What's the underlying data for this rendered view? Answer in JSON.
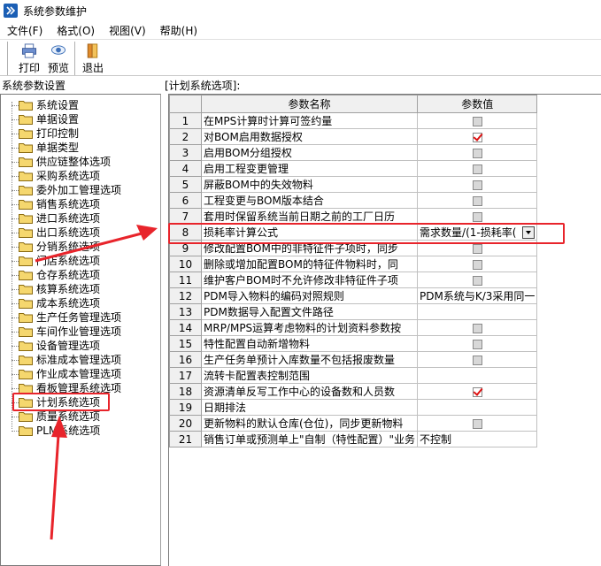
{
  "window": {
    "title": "系统参数维护"
  },
  "menu": [
    {
      "label": "文件(F)"
    },
    {
      "label": "格式(O)"
    },
    {
      "label": "视图(V)"
    },
    {
      "label": "帮助(H)"
    }
  ],
  "toolbar": {
    "print_label": "打印",
    "preview_label": "预览",
    "exit_label": "退出"
  },
  "left_panel": {
    "header": "系统参数设置"
  },
  "tree_items": [
    {
      "label": "系统设置"
    },
    {
      "label": "单据设置"
    },
    {
      "label": "打印控制"
    },
    {
      "label": "单据类型"
    },
    {
      "label": "供应链整体选项"
    },
    {
      "label": "采购系统选项"
    },
    {
      "label": "委外加工管理选项"
    },
    {
      "label": "销售系统选项"
    },
    {
      "label": "进口系统选项"
    },
    {
      "label": "出口系统选项"
    },
    {
      "label": "分销系统选项"
    },
    {
      "label": "门店系统选项"
    },
    {
      "label": "仓存系统选项"
    },
    {
      "label": "核算系统选项"
    },
    {
      "label": "成本系统选项"
    },
    {
      "label": "生产任务管理选项"
    },
    {
      "label": "车间作业管理选项"
    },
    {
      "label": "设备管理选项"
    },
    {
      "label": "标准成本管理选项"
    },
    {
      "label": "作业成本管理选项"
    },
    {
      "label": "看板管理系统选项"
    },
    {
      "label": "计划系统选项"
    },
    {
      "label": "质量系统选项"
    },
    {
      "label": "PLM系统选项"
    }
  ],
  "right_panel": {
    "header": "[计划系统选项]:"
  },
  "grid": {
    "col_name": "参数名称",
    "col_value": "参数值",
    "rows": [
      {
        "n": "1",
        "name": "在MPS计算时计算可签约量",
        "type": "cb",
        "checked": false
      },
      {
        "n": "2",
        "name": "对BOM启用数据授权",
        "type": "cb",
        "checked": true
      },
      {
        "n": "3",
        "name": "启用BOM分组授权",
        "type": "cb",
        "checked": false
      },
      {
        "n": "4",
        "name": "启用工程变更管理",
        "type": "cb",
        "checked": false
      },
      {
        "n": "5",
        "name": "屏蔽BOM中的失效物料",
        "type": "cb",
        "checked": false
      },
      {
        "n": "6",
        "name": "工程变更与BOM版本结合",
        "type": "cb",
        "checked": false
      },
      {
        "n": "7",
        "name": "套用时保留系统当前日期之前的工厂日历",
        "type": "cb",
        "checked": false
      },
      {
        "n": "8",
        "name": "损耗率计算公式",
        "type": "dd",
        "value": "需求数量/(1-损耗率("
      },
      {
        "n": "9",
        "name": "修改配置BOM中的非特征件子项时，同步",
        "type": "cb",
        "checked": false
      },
      {
        "n": "10",
        "name": "删除或增加配置BOM的特征件物料时，同",
        "type": "cb",
        "checked": false
      },
      {
        "n": "11",
        "name": "维护客户BOM时不允许修改非特征件子项",
        "type": "cb",
        "checked": false
      },
      {
        "n": "12",
        "name": "PDM导入物料的编码对照规则",
        "type": "text",
        "value": "PDM系统与K/3采用同一"
      },
      {
        "n": "13",
        "name": "PDM数据导入配置文件路径",
        "type": "text",
        "value": ""
      },
      {
        "n": "14",
        "name": "MRP/MPS运算考虑物料的计划资料参数按",
        "type": "cb",
        "checked": false
      },
      {
        "n": "15",
        "name": "特性配置自动新增物料",
        "type": "cb",
        "checked": false
      },
      {
        "n": "16",
        "name": "生产任务单预计入库数量不包括报废数量",
        "type": "cb",
        "checked": false
      },
      {
        "n": "17",
        "name": "流转卡配置表控制范围",
        "type": "text",
        "value": ""
      },
      {
        "n": "18",
        "name": "资源清单反写工作中心的设备数和人员数",
        "type": "cb",
        "checked": true
      },
      {
        "n": "19",
        "name": "日期排法",
        "type": "text",
        "value": ""
      },
      {
        "n": "20",
        "name": "更新物料的默认仓库(仓位)，同步更新物料",
        "type": "cb",
        "checked": false
      },
      {
        "n": "21",
        "name": "销售订单或预测单上\"自制（特性配置）\"业务",
        "type": "text",
        "value": "不控制"
      }
    ]
  },
  "colors": {
    "highlight": "#e8242b",
    "folder": "#f5d76e"
  }
}
